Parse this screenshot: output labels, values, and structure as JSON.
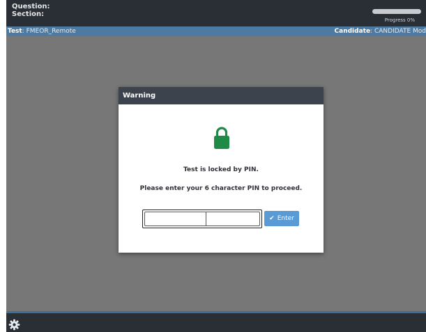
{
  "header": {
    "question_label": "Question:",
    "section_label": "Section:",
    "progress_text": "Progress 0%",
    "progress_fraction": 0.0
  },
  "infobar": {
    "test_key": "Test",
    "test_value": ": FMEOR_Remote",
    "candidate_key": "Candidate",
    "candidate_value": ": CANDIDATE Mod"
  },
  "modal": {
    "title": "Warning",
    "lock_icon": "padlock-icon",
    "lock_color": "#1e8a46",
    "message_line1": "Test is locked by PIN.",
    "message_line2": "Please enter your 6 character PIN to proceed.",
    "pin_value": "",
    "enter_label": "Enter",
    "enter_icon": "checkmark-icon"
  },
  "footer": {
    "settings_icon": "gear-icon"
  },
  "colors": {
    "background": "#777777",
    "bar": "#2a2e35",
    "accent": "#5b9bd5",
    "infobar": "#4d7aa1"
  }
}
